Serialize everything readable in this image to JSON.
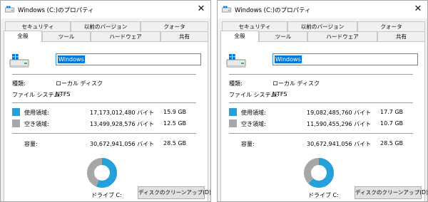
{
  "colors": {
    "used": "#26a0da",
    "free": "#a7a7a7",
    "accent": "#0078d7"
  },
  "windows": [
    {
      "title": "Windows (C:)のプロパティ",
      "tabs_top": [
        "セキュリティ",
        "以前のバージョン",
        "クォータ"
      ],
      "tabs_bottom": [
        "全般",
        "ツール",
        "ハードウェア",
        "共有"
      ],
      "active_tab": "全般",
      "drive_name": "Windows",
      "type_label": "種類:",
      "type_value": "ローカル ディスク",
      "fs_label": "ファイル システム:",
      "fs_value": "NTFS",
      "used_label": "使用領域:",
      "used_bytes": "17,173,012,480 バイト",
      "used_gb": "15.9 GB",
      "free_label": "空き領域:",
      "free_bytes": "13,499,928,576 バイト",
      "free_gb": "12.5 GB",
      "cap_label": "容量:",
      "cap_bytes": "30,672,941,056 バイト",
      "cap_gb": "28.5 GB",
      "drive_label": "ドライブ C:",
      "cleanup_label": "ディスクのクリーンアップ(D)",
      "used_fraction": 0.56
    },
    {
      "title": "Windows (C:)のプロパティ",
      "tabs_top": [
        "セキュリティ",
        "以前のバージョン",
        "クォータ"
      ],
      "tabs_bottom": [
        "全般",
        "ツール",
        "ハードウェア",
        "共有"
      ],
      "active_tab": "全般",
      "drive_name": "Windows",
      "type_label": "種類:",
      "type_value": "ローカル ディスク",
      "fs_label": "ファイル システム:",
      "fs_value": "NTFS",
      "used_label": "使用領域:",
      "used_bytes": "19,082,485,760 バイト",
      "used_gb": "17.7 GB",
      "free_label": "空き領域:",
      "free_bytes": "11,590,455,296 バイト",
      "free_gb": "10.7 GB",
      "cap_label": "容量:",
      "cap_bytes": "30,672,941,056 バイト",
      "cap_gb": "28.5 GB",
      "drive_label": "ドライブ C:",
      "cleanup_label": "ディスクのクリーンアップ(D)",
      "used_fraction": 0.62
    }
  ]
}
